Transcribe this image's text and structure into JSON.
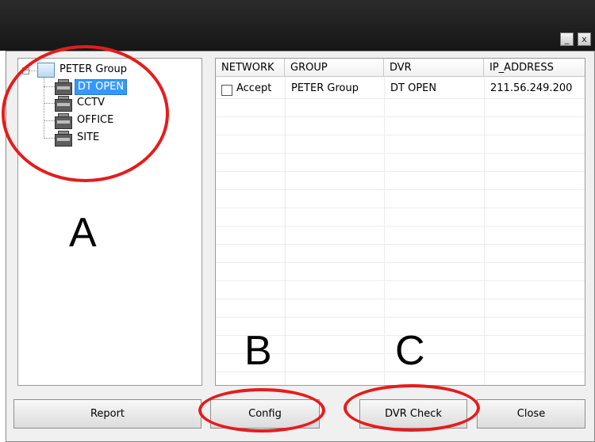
{
  "window": {
    "minimize_glyph": "_",
    "close_glyph": "x"
  },
  "tree": {
    "root": {
      "label": "PETER Group",
      "expander": "−",
      "icon": "group-icon"
    },
    "children": [
      {
        "label": "DT OPEN",
        "selected": true,
        "icon": "dvr-icon"
      },
      {
        "label": "CCTV",
        "icon": "dvr-icon"
      },
      {
        "label": "OFFICE",
        "icon": "dvr-icon"
      },
      {
        "label": "SITE",
        "icon": "dvr-icon"
      }
    ]
  },
  "table": {
    "columns": [
      "NETWORK",
      "GROUP",
      "DVR",
      "IP_ADDRESS"
    ],
    "rows": [
      {
        "network": "Accept",
        "checked": false,
        "group": "PETER Group",
        "dvr": "DT OPEN",
        "ip": "211.56.249.200"
      }
    ]
  },
  "buttons": {
    "report": "Report",
    "config": "Config",
    "dvr_check": "DVR Check",
    "close": "Close"
  },
  "annotations": {
    "a": "A",
    "b": "B",
    "c": "C",
    "ellipse_color": "#e51c1c"
  }
}
